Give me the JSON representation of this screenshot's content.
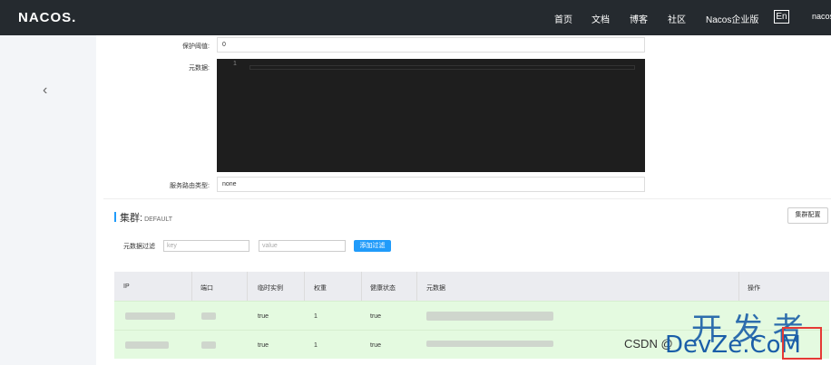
{
  "header": {
    "logo": "NACOS.",
    "nav": [
      "首页",
      "文档",
      "博客",
      "社区",
      "Nacos企业版"
    ],
    "lang": "En",
    "user_cut": "nacos"
  },
  "form": {
    "threshold_label": "保护阈值:",
    "threshold_value": "0",
    "metadata_label": "元数据:",
    "editor_line": "1",
    "selector_label": "服务路由类型:",
    "selector_value": "none"
  },
  "cluster": {
    "title": "集群:",
    "name": "DEFAULT",
    "config_button": "集群配置",
    "filter_label": "元数据过滤",
    "key_placeholder": "key",
    "value_placeholder": "value",
    "add_filter_button": "添加过滤"
  },
  "table": {
    "columns": [
      "IP",
      "端口",
      "临时实例",
      "权重",
      "健康状态",
      "元数据",
      "操作"
    ],
    "rows": [
      {
        "ephemeral": "true",
        "weight": "1",
        "healthy": "true"
      },
      {
        "ephemeral": "true",
        "weight": "1",
        "healthy": "true"
      }
    ]
  },
  "watermark": {
    "big": "开 发 者",
    "csdn": "CSDN @",
    "site": "DevZe.CoM"
  },
  "colors": {
    "accent": "#209bfa",
    "topbar": "#252a2f",
    "row_bg": "#e4fae0"
  }
}
